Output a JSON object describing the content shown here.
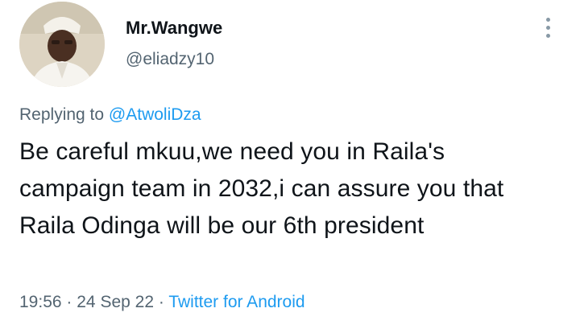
{
  "user": {
    "display_name": "Mr.Wangwe",
    "handle": "@eliadzy10"
  },
  "reply": {
    "prefix": "Replying to",
    "mention": "@AtwoliDza"
  },
  "tweet": {
    "text": "Be careful mkuu,we need you in Raila's campaign team in 2032,i can assure you that Raila Odinga will be our 6th president"
  },
  "meta": {
    "time": "19:56",
    "separator": "·",
    "date": "24 Sep 22",
    "source": "Twitter for Android"
  },
  "colors": {
    "text": "#0f1419",
    "secondary": "#536471",
    "link": "#1d9bf0"
  },
  "icons": {
    "more": "more-vertical-icon"
  }
}
